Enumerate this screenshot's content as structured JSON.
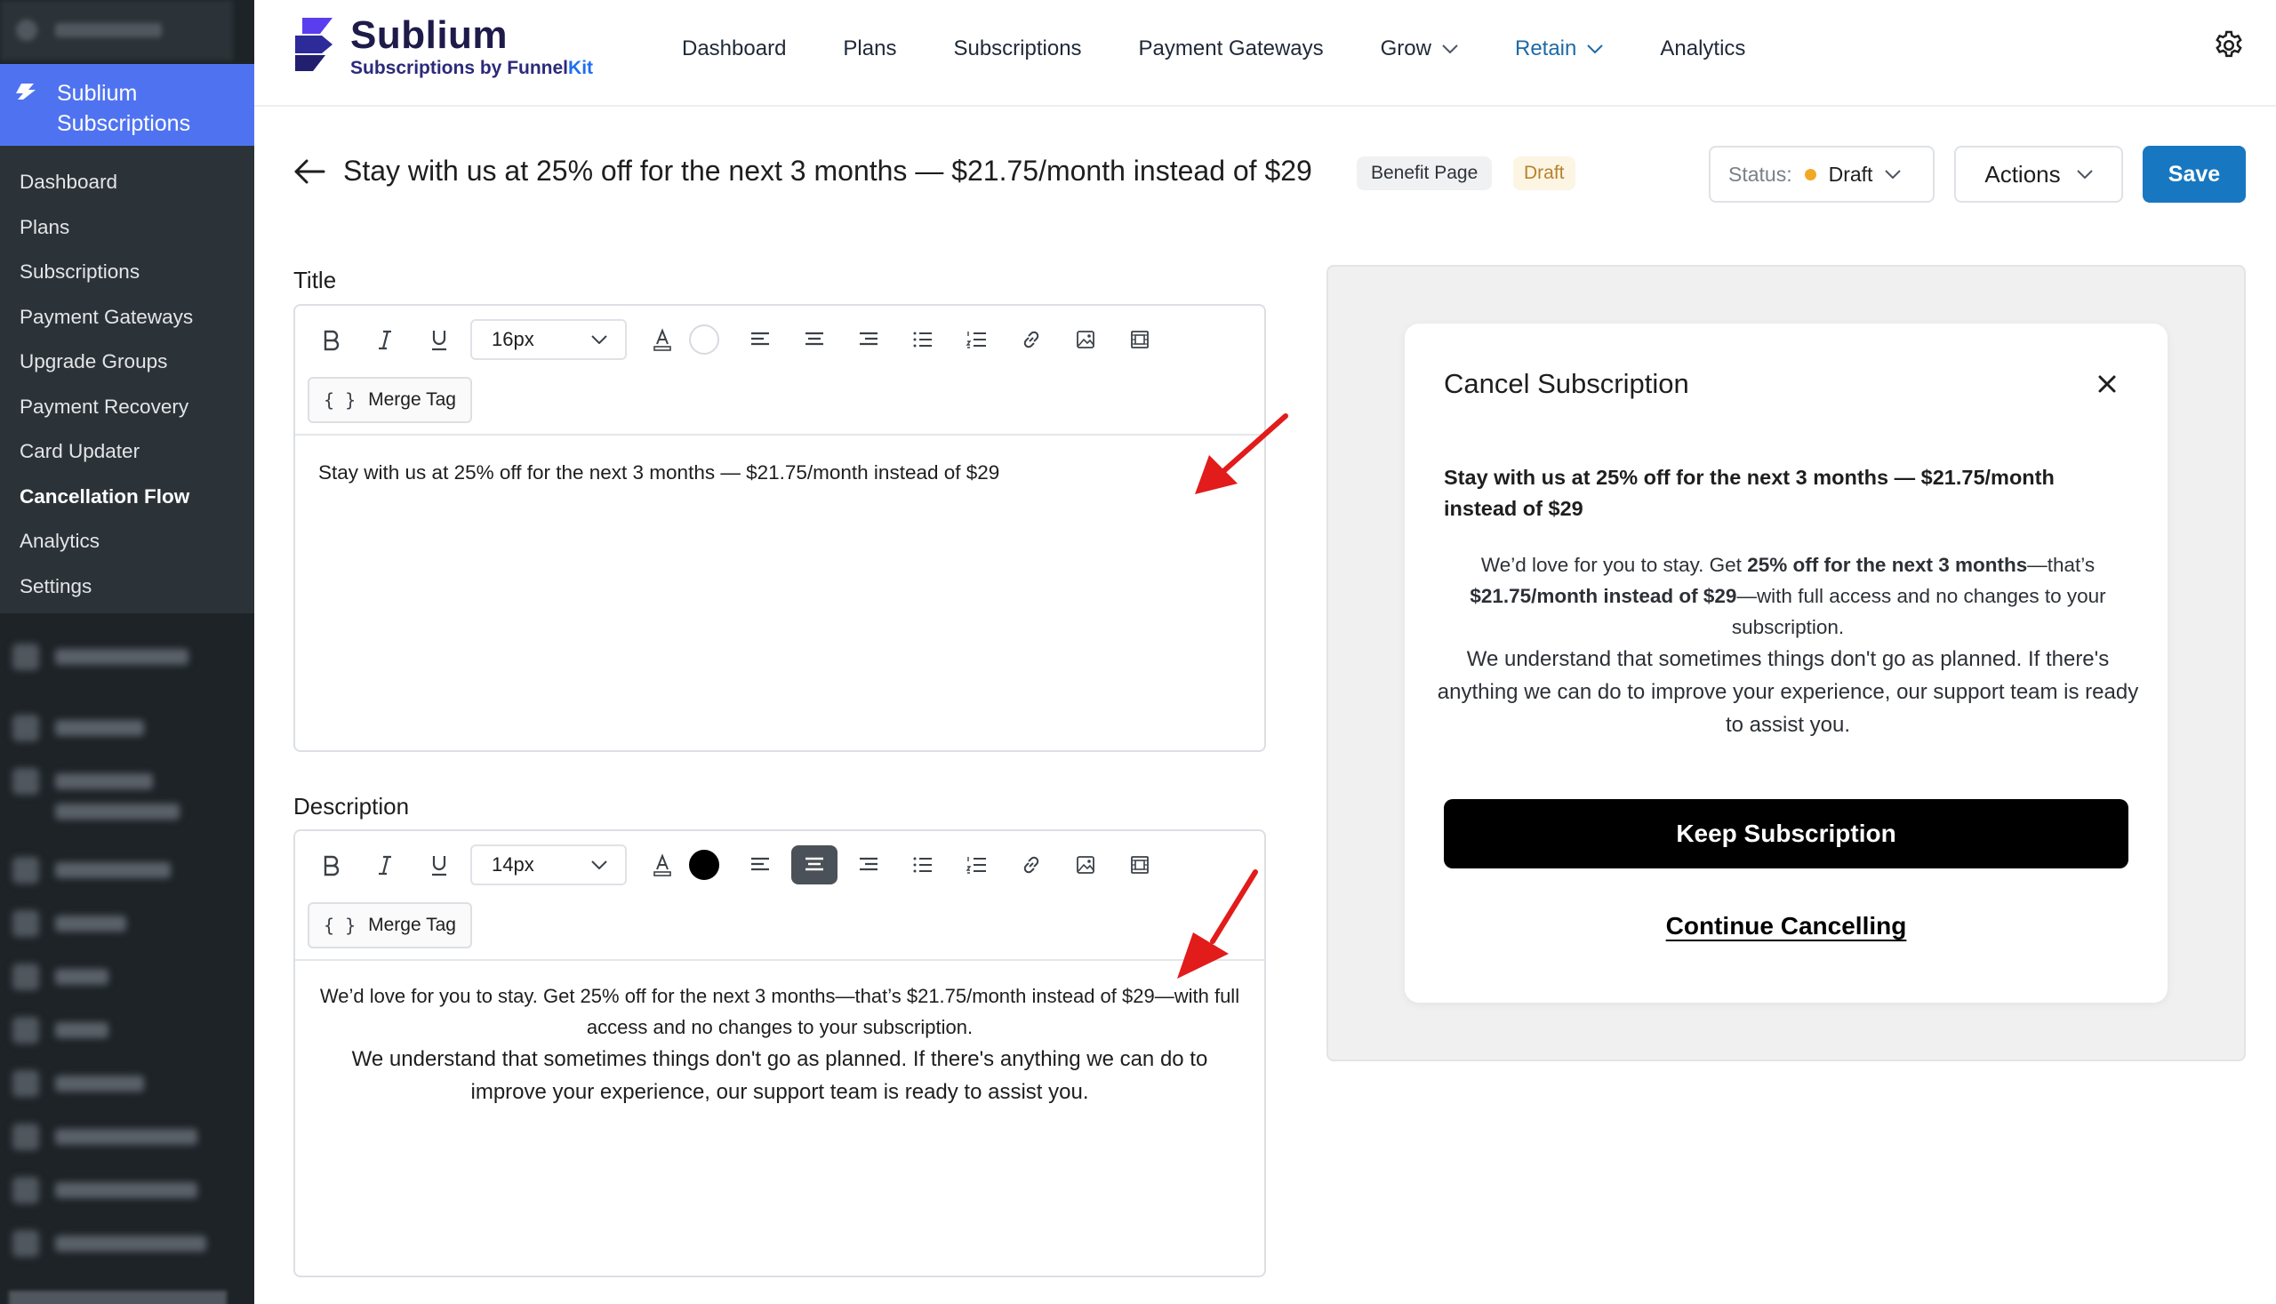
{
  "wp_sidebar": {
    "active_plugin_label": "Sublium Subscriptions",
    "submenu": [
      "Dashboard",
      "Plans",
      "Subscriptions",
      "Payment Gateways",
      "Upgrade Groups",
      "Payment Recovery",
      "Card Updater",
      "Cancellation Flow",
      "Analytics",
      "Settings"
    ],
    "current_item": "Cancellation Flow"
  },
  "brand": {
    "name": "Sublium",
    "sub_prefix": "Subscriptions by Funnel",
    "sub_suffix": "Kit"
  },
  "nav": {
    "items": [
      {
        "label": "Dashboard"
      },
      {
        "label": "Plans"
      },
      {
        "label": "Subscriptions"
      },
      {
        "label": "Payment Gateways"
      },
      {
        "label": "Grow",
        "dropdown": true
      },
      {
        "label": "Retain",
        "dropdown": true,
        "active": true
      },
      {
        "label": "Analytics"
      }
    ]
  },
  "page": {
    "title": "Stay with us at 25% off for the next 3 months — $21.75/month instead of $29",
    "badge_type": "Benefit Page",
    "badge_status": "Draft",
    "status_label": "Status:",
    "status_value": "Draft",
    "actions_label": "Actions",
    "save_label": "Save"
  },
  "title_editor": {
    "label": "Title",
    "font_size": "16px",
    "merge_tag_label": "Merge Tag",
    "content": "Stay with us at 25% off for the next 3 months — $21.75/month instead of $29"
  },
  "description_editor": {
    "label": "Description",
    "font_size": "14px",
    "merge_tag_label": "Merge Tag",
    "paragraph_1": "We’d love for you to stay. Get 25% off for the next 3 months—that’s $21.75/month instead of $29—with full access and no changes to your subscription.",
    "paragraph_2": "We understand that sometimes things don't go as planned. If there's anything we can do to improve your experience, our support team is ready to assist you."
  },
  "preview": {
    "modal_title": "Cancel Subscription",
    "heading": "Stay with us at 25% off for the next 3 months — $21.75/month instead of $29",
    "desc_lead": "We’d love for you to stay. Get ",
    "desc_bold_1": "25% off for the next 3 months",
    "desc_mid": "—that’s ",
    "desc_bold_2": "$21.75/month instead of $29",
    "desc_tail": "—with full access and no changes to your subscription.",
    "desc_2": "We understand that sometimes things don't go as planned. If there's anything we can do to improve your experience, our support team is ready to assist you.",
    "keep_label": "Keep Subscription",
    "continue_label": "Continue Cancelling"
  },
  "colors": {
    "wp_sidebar_bg": "#1d2327",
    "plugin_active": "#4f73f0",
    "save_button": "#1877c1",
    "nav_active": "#1d6aa8",
    "draft_dot": "#f1a925",
    "annotation_arrow": "#e21b1b"
  },
  "icons": [
    "sublium-logo",
    "chevron-down-icon",
    "gear-icon",
    "back-arrow-icon",
    "bold-icon",
    "italic-icon",
    "underline-icon",
    "text-color-icon",
    "align-left-icon",
    "align-center-icon",
    "align-right-icon",
    "bullet-list-icon",
    "numbered-list-icon",
    "link-icon",
    "image-icon",
    "video-icon",
    "close-icon"
  ]
}
